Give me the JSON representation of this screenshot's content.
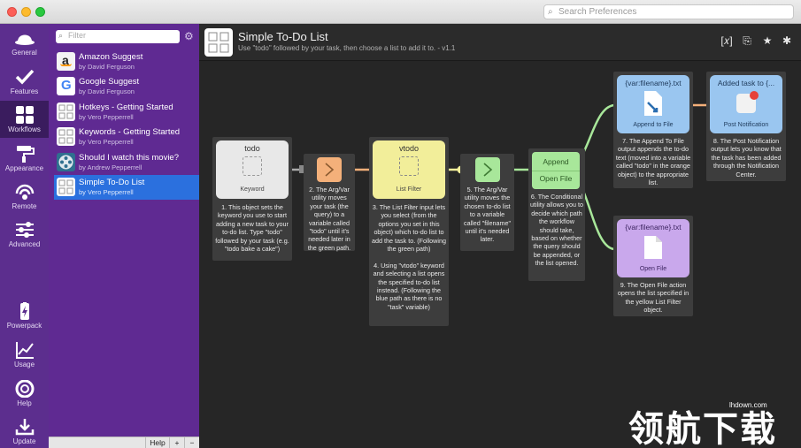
{
  "window": {
    "search_placeholder": "Search Preferences"
  },
  "nav": {
    "items": [
      {
        "label": "General",
        "icon": "hat-icon"
      },
      {
        "label": "Features",
        "icon": "checkmark-icon"
      },
      {
        "label": "Workflows",
        "icon": "grid-icon",
        "active": true
      },
      {
        "label": "Appearance",
        "icon": "paint-roller-icon"
      },
      {
        "label": "Remote",
        "icon": "remote-icon"
      },
      {
        "label": "Advanced",
        "icon": "sliders-icon"
      },
      {
        "label": "Powerpack",
        "icon": "battery-icon"
      },
      {
        "label": "Usage",
        "icon": "chart-icon"
      },
      {
        "label": "Help",
        "icon": "lifebuoy-icon"
      },
      {
        "label": "Update",
        "icon": "download-icon"
      }
    ]
  },
  "workflows": {
    "filter_placeholder": "Filter",
    "items": [
      {
        "title": "Amazon Suggest",
        "author": "by David Ferguson"
      },
      {
        "title": "Google Suggest",
        "author": "by David Ferguson"
      },
      {
        "title": "Hotkeys - Getting Started",
        "author": "by Vero Pepperrell"
      },
      {
        "title": "Keywords - Getting Started",
        "author": "by Vero Pepperrell"
      },
      {
        "title": "Should I watch this movie?",
        "author": "by Andrew Pepperrell"
      },
      {
        "title": "Simple To-Do List",
        "author": "by Vero Pepperrell",
        "selected": true
      }
    ],
    "bottom": {
      "help": "Help",
      "add": "+",
      "remove": "−"
    }
  },
  "editor": {
    "title": "Simple To-Do List",
    "subtitle": "Use \"todo\" followed by your task, then choose a list to add it to. - v1.1",
    "toolbar": {
      "vars": "[𝑥]",
      "export": "⎘",
      "share": "★",
      "debug": "✱"
    }
  },
  "objects": {
    "keyword": {
      "title": "todo",
      "type": "Keyword",
      "desc": "1. This object sets the keyword you use to start adding a new task to your to-do list. Type \"todo\" followed by your task (e.g. \"todo bake a cake\")"
    },
    "argvar1": {
      "desc": "2. The Arg/Var utility moves your task (the query) to a variable called \"todo\" until it's needed later in the green path."
    },
    "listfilter": {
      "title": "vtodo",
      "type": "List Filter",
      "desc": "3. The List Filter input lets you select (from the options you set in this object) which to-do list to add the task to. (Following the green path)\n\n4. Using \"vtodo\" keyword and selecting a list opens the specified to-do list instead. (Following the blue path as there is no \"task\" variable)"
    },
    "argvar2": {
      "desc": "5. The Arg/Var utility moves the chosen to-do list to a variable called \"filename\" until it's needed later."
    },
    "conditional": {
      "append": "Append",
      "open": "Open File",
      "desc": "6. The Conditional utility allows you to decide which path the workflow should take, based on whether the query should be appended, or the list opened."
    },
    "appendfile": {
      "title": "{var:filename}.txt",
      "type": "Append to File",
      "desc": "7. The Append To File output appends the to-do text (moved into a variable called \"todo\" in the orange object) to the appropriate list."
    },
    "notification": {
      "title": "Added task to {...",
      "type": "Post Notification",
      "desc": "8. The Post Notification output lets you know that the task has been added through the Notification Center."
    },
    "openfile": {
      "title": "{var:filename}.txt",
      "type": "Open File",
      "desc": "9. The Open File action opens the list specified in the yellow List Filter object."
    }
  },
  "watermark": {
    "text": "领航下载",
    "site": "lhdown.com"
  },
  "colors": {
    "nav_bg": "#5c2e8e",
    "selection": "#2b70de",
    "keyword_node": "#e8e8e8",
    "argvar_node": "#f4b07a",
    "listfilter_node": "#f2ee9a",
    "conditional_node": "#a8e79a",
    "output_node": "#9ac6f0",
    "openfile_node": "#c9a8ec",
    "green_wire": "#a8e79a",
    "orange_wire": "#f4b07a",
    "blue_wire": "#9ac6f0"
  }
}
